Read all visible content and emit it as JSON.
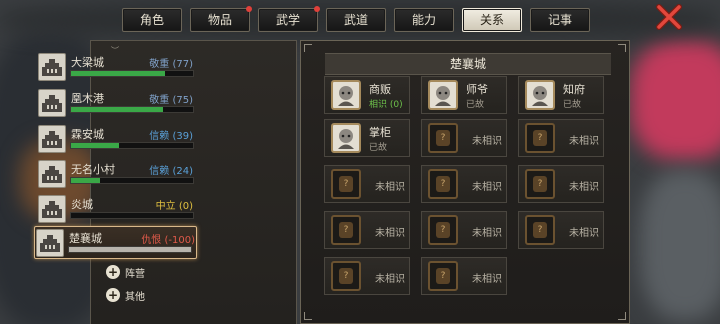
{
  "tabs": [
    {
      "label": "角色",
      "active": false,
      "badge": false
    },
    {
      "label": "物品",
      "active": false,
      "badge": true
    },
    {
      "label": "武学",
      "active": false,
      "badge": true
    },
    {
      "label": "武道",
      "active": false,
      "badge": false
    },
    {
      "label": "能力",
      "active": false,
      "badge": false
    },
    {
      "label": "关系",
      "active": true,
      "badge": false
    },
    {
      "label": "记事",
      "active": false,
      "badge": false
    }
  ],
  "close": {
    "icon": "close-x-icon",
    "color": "#e2473c"
  },
  "cities": [
    {
      "name": "大梁城",
      "status": "敬重 (77)",
      "status_color": "#7fa0c8",
      "bar": 0.77,
      "bar_color": "#3aa847",
      "selected": false
    },
    {
      "name": "凰木港",
      "status": "敬重 (75)",
      "status_color": "#7fa0c8",
      "bar": 0.75,
      "bar_color": "#3aa847",
      "selected": false
    },
    {
      "name": "霖安城",
      "status": "信赖 (39)",
      "status_color": "#5aa0d8",
      "bar": 0.39,
      "bar_color": "#3aa847",
      "selected": false
    },
    {
      "name": "无名小村",
      "status": "信赖 (24)",
      "status_color": "#5aa0d8",
      "bar": 0.24,
      "bar_color": "#3aa847",
      "selected": false
    },
    {
      "name": "炎城",
      "status": "中立 (0)",
      "status_color": "#e0c040",
      "bar": 0.0,
      "bar_color": "#3aa847",
      "selected": false
    },
    {
      "name": "楚襄城",
      "status": "仇恨 (-100)",
      "status_color": "#e05a4a",
      "bar": 1.0,
      "bar_color": "#b8b4ac",
      "selected": true
    }
  ],
  "groups": [
    {
      "label": "阵营"
    },
    {
      "label": "其他"
    }
  ],
  "panel_title": "楚襄城",
  "npcs": [
    {
      "name": "商贩",
      "status": "相识 (0)",
      "status_color": "#6cc04a",
      "known": true
    },
    {
      "name": "师爷",
      "status": "已故",
      "status_color": "#a29c8f",
      "known": true
    },
    {
      "name": "知府",
      "status": "已故",
      "status_color": "#a29c8f",
      "known": true
    },
    {
      "name": "掌柜",
      "status": "已故",
      "status_color": "#a29c8f",
      "known": true
    },
    {
      "unknown_label": "未相识",
      "known": false
    },
    {
      "unknown_label": "未相识",
      "known": false
    },
    {
      "unknown_label": "未相识",
      "known": false
    },
    {
      "unknown_label": "未相识",
      "known": false
    },
    {
      "unknown_label": "未相识",
      "known": false
    },
    {
      "unknown_label": "未相识",
      "known": false
    },
    {
      "unknown_label": "未相识",
      "known": false
    },
    {
      "unknown_label": "未相识",
      "known": false
    },
    {
      "unknown_label": "未相识",
      "known": false
    },
    {
      "unknown_label": "未相识",
      "known": false
    }
  ]
}
